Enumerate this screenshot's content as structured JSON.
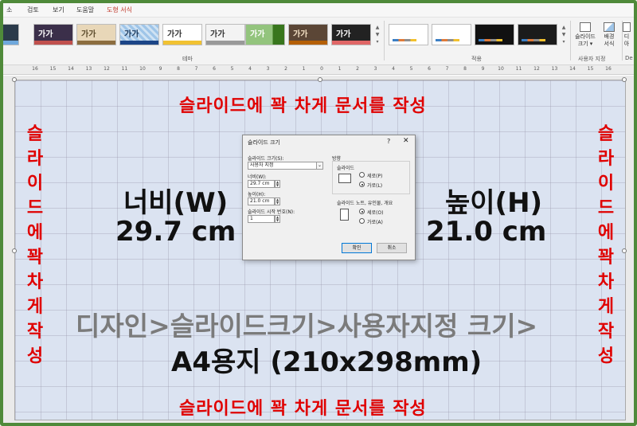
{
  "menu": {
    "tabs": [
      "소",
      "검토",
      "보기",
      "도움말",
      "도형 서식"
    ],
    "active_tab": "도형 서식"
  },
  "ribbon": {
    "theme_thumb_text": "가가",
    "theme_group_label": "테마",
    "variants_group_label": "적용",
    "slide_size_label_1": "슬라이드",
    "slide_size_label_2": "크기 ▾",
    "bg_format_label_1": "배경",
    "bg_format_label_2": "서식",
    "customize_group_label": "사용자 지정",
    "designer_label_1": "디",
    "designer_label_2": "아",
    "designer_group_label": "De"
  },
  "ruler": {
    "numbers": [
      "16",
      "15",
      "14",
      "13",
      "12",
      "11",
      "10",
      "9",
      "8",
      "7",
      "6",
      "5",
      "4",
      "3",
      "2",
      "1",
      "0",
      "1",
      "2",
      "3",
      "4",
      "5",
      "6",
      "7",
      "8",
      "9",
      "10",
      "11",
      "12",
      "13",
      "14",
      "15",
      "16"
    ]
  },
  "slide": {
    "top_title": "슬라이드에 꽉 차게 문서를 작성",
    "bottom_title": "슬라이드에 꽉 차게 문서를 작성",
    "left_vertical": "슬라이드에꽉차게작성",
    "right_vertical": "슬라이드에꽉차게작성",
    "width_label": "너비(W)",
    "width_value": "29.7 cm",
    "height_label": "높이(H)",
    "height_value": "21.0 cm",
    "path_text": "디자인>슬라이드크기>사용자지정 크기>",
    "paper_text": "A4용지 (210x298mm)"
  },
  "dialog": {
    "title": "슬라이드 크기",
    "help": "?",
    "close": "✕",
    "size_for_label": "슬라이드 크기(S):",
    "size_for_value": "사용자 지정",
    "width_label": "너비(W):",
    "width_value": "29.7 cm",
    "height_label": "높이(H):",
    "height_value": "21.0 cm",
    "start_label": "슬라이드 시작 번호(N):",
    "start_value": "1",
    "orientation_label": "방향",
    "slides_label": "슬라이드",
    "portrait_label": "세로(P)",
    "landscape_label": "가로(L)",
    "notes_label": "슬라이드 노트, 유인물, 개요",
    "notes_portrait_label": "세로(O)",
    "notes_landscape_label": "가로(A)",
    "ok_label": "확인",
    "cancel_label": "취소"
  },
  "colors": {
    "frame": "#4f8a3a",
    "title_red": "#e00000",
    "slide_bg": "#dbe3f1"
  }
}
